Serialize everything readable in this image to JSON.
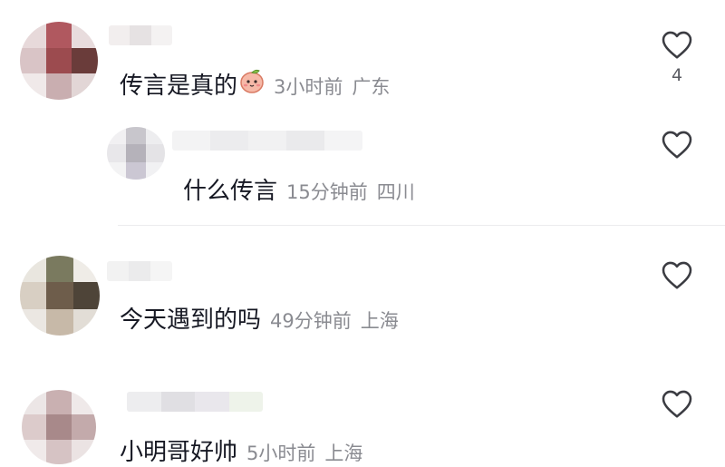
{
  "comments": [
    {
      "text": "传言是真的",
      "emoji": "peach-emoji",
      "time": "3小时前",
      "location": "广东",
      "like_icon": "heart-outline-icon",
      "like_count": "4"
    },
    {
      "text": "什么传言",
      "time": "15分钟前",
      "location": "四川",
      "like_icon": "heart-outline-icon",
      "like_count": ""
    },
    {
      "text": "今天遇到的吗",
      "time": "49分钟前",
      "location": "上海",
      "like_icon": "heart-outline-icon",
      "like_count": ""
    },
    {
      "text": "小明哥好帅",
      "time": "5小时前",
      "location": "上海",
      "like_icon": "heart-outline-icon",
      "like_count": ""
    }
  ],
  "colors": {
    "text_primary": "#161823",
    "text_meta": "#8a8b91",
    "divider": "#ececee"
  }
}
